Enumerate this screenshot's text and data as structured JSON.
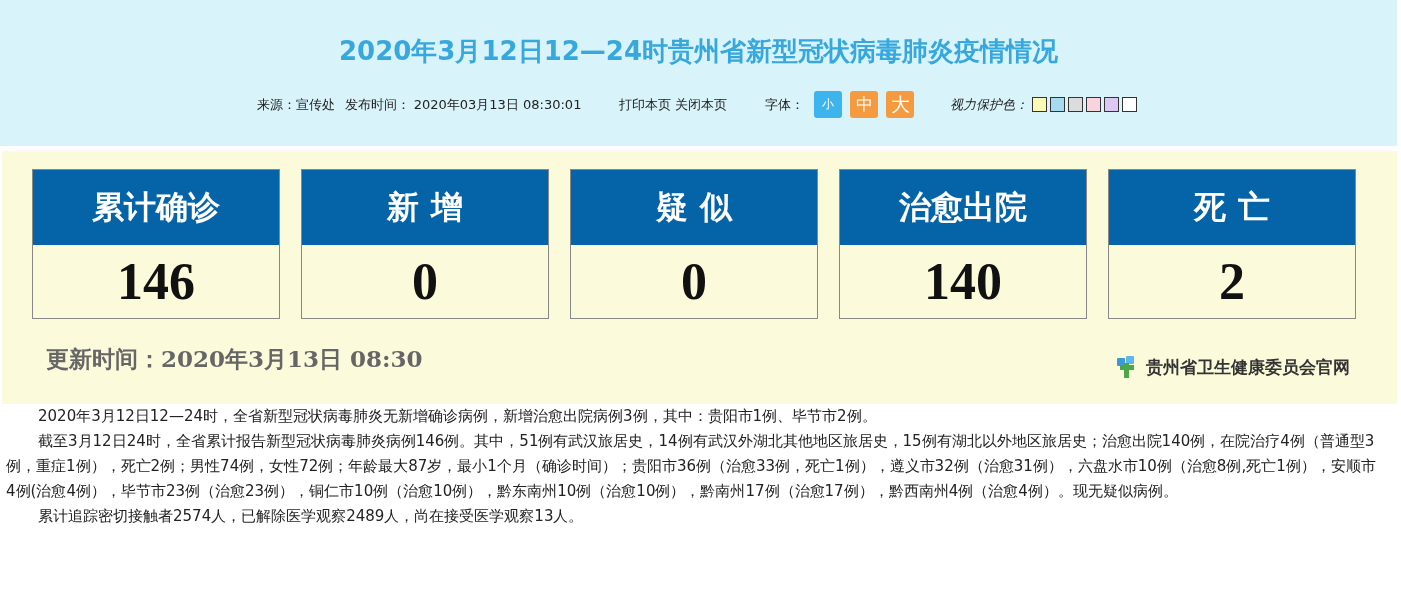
{
  "header": {
    "title": "2020年3月12日12—24时贵州省新型冠状病毒肺炎疫情情况",
    "source": "来源：宣传处",
    "published": "发布时间： 2020年03月13日 08:30:01",
    "links": [
      "打印本页",
      "关闭本页"
    ],
    "font_label": "字体：",
    "font_sizes": [
      {
        "label": "小",
        "selected": true
      },
      {
        "label": "中",
        "selected": false
      },
      {
        "label": "大",
        "selected": false
      }
    ],
    "eye_care_label": "视力保护色：",
    "eye_care_colors": [
      {
        "color": "#fafab4"
      },
      {
        "color": "#a8daf0"
      },
      {
        "color": "#dcdcdc"
      },
      {
        "color": "#fad4dc"
      },
      {
        "color": "#dcc8f5"
      },
      {
        "color": "#ffffff"
      }
    ]
  },
  "stats": {
    "cards": [
      {
        "label": "累计确诊",
        "value": "146"
      },
      {
        "label": "新 增",
        "value": "0"
      },
      {
        "label": "疑 似",
        "value": "0"
      },
      {
        "label": "治愈出院",
        "value": "140"
      },
      {
        "label": "死 亡",
        "value": "2"
      }
    ],
    "updated": "更新时间：2020年3月13日   08:30",
    "source_name": "贵州省卫生健康委员会官网"
  },
  "paragraphs": [
    "2020年3月12日12—24时，全省新型冠状病毒肺炎无新增确诊病例，新增治愈出院病例3例，其中：贵阳市1例、毕节市2例。",
    "截至3月12日24时，全省累计报告新型冠状病毒肺炎病例146例。其中，51例有武汉旅居史，14例有武汉外湖北其他地区旅居史，15例有湖北以外地区旅居史；治愈出院140例，在院治疗4例（普通型3例，重症1例），死亡2例；男性74例，女性72例；年龄最大87岁，最小1个月（确诊时间）；贵阳市36例（治愈33例，死亡1例），遵义市32例（治愈31例），六盘水市10例（治愈8例,死亡1例），安顺市4例(治愈4例），毕节市23例（治愈23例），铜仁市10例（治愈10例），黔东南州10例（治愈10例），黔南州17例（治愈17例），黔西南州4例（治愈4例）。现无疑似病例。",
    "累计追踪密切接触者2574人，已解除医学观察2489人，尚在接受医学观察13人。"
  ]
}
